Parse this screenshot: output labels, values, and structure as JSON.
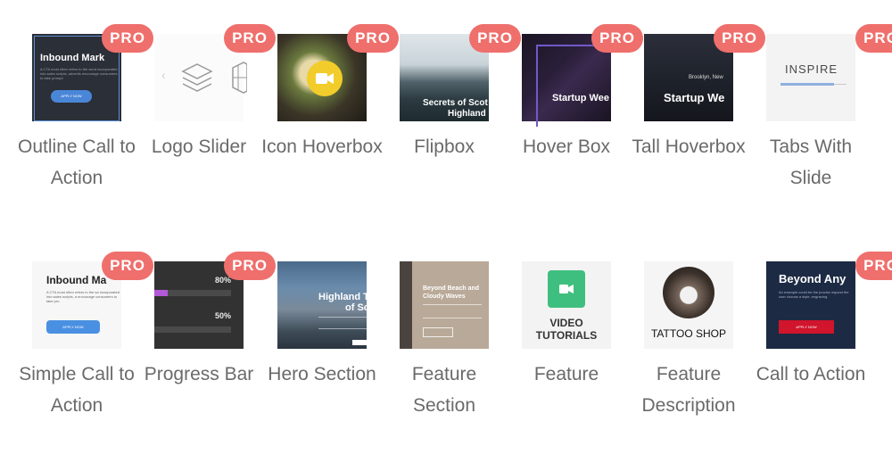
{
  "badge_text": "PRO",
  "widgets": [
    {
      "label": "Outline Call to Action",
      "pro": true,
      "thumb": {
        "heading": "Inbound Mark",
        "body": "A CTA most often refers to the word incorporated into sales scripts, advertis encourage consumers to take prompt",
        "button": "APPLY NOW"
      }
    },
    {
      "label": "Logo Slider",
      "pro": true,
      "thumb": {
        "arrow": "‹"
      }
    },
    {
      "label": "Icon Hoverbox",
      "pro": true,
      "thumb": {}
    },
    {
      "label": "Flipbox",
      "pro": true,
      "thumb": {
        "caption": "Secrets of Scot",
        "caption2": "Highland"
      }
    },
    {
      "label": "Hover Box",
      "pro": true,
      "thumb": {
        "caption": "Startup Wee"
      }
    },
    {
      "label": "Tall Hoverbox",
      "pro": true,
      "thumb": {
        "small": "Brooklyn, New",
        "caption": "Startup We"
      }
    },
    {
      "label": "Tabs With Slide",
      "pro": true,
      "thumb": {
        "caption": "INSPIRE"
      }
    },
    {
      "label": "Simple Call to Action",
      "pro": true,
      "thumb": {
        "heading": "Inbound Ma",
        "body": "A CTA most often refers to the sa incorporated into sales scripts, a encourage consumers to take pro",
        "button": "APPLY NOW"
      }
    },
    {
      "label": "Progress Bar",
      "pro": true,
      "thumb": {
        "p1": "80%",
        "p2": "50%",
        "fill1": 0.18,
        "fill2": 0
      }
    },
    {
      "label": "Hero Section",
      "pro": false,
      "thumb": {
        "caption": "Highland T",
        "caption2": "of Scot"
      }
    },
    {
      "label": "Feature Section",
      "pro": false,
      "thumb": {
        "caption": "Beyond Beach and Cloudy Waves"
      }
    },
    {
      "label": "Feature",
      "pro": false,
      "thumb": {
        "caption": "VIDEO TUTORIALS"
      }
    },
    {
      "label": "Feature Description",
      "pro": false,
      "thumb": {
        "caption": "TATTOO SHOP"
      }
    },
    {
      "label": "Call to Action",
      "pro": true,
      "thumb": {
        "heading": "Beyond Any",
        "body": "An example could be the purcha request the user choose a style, engraving.",
        "button": "APPLY NOW"
      }
    }
  ]
}
